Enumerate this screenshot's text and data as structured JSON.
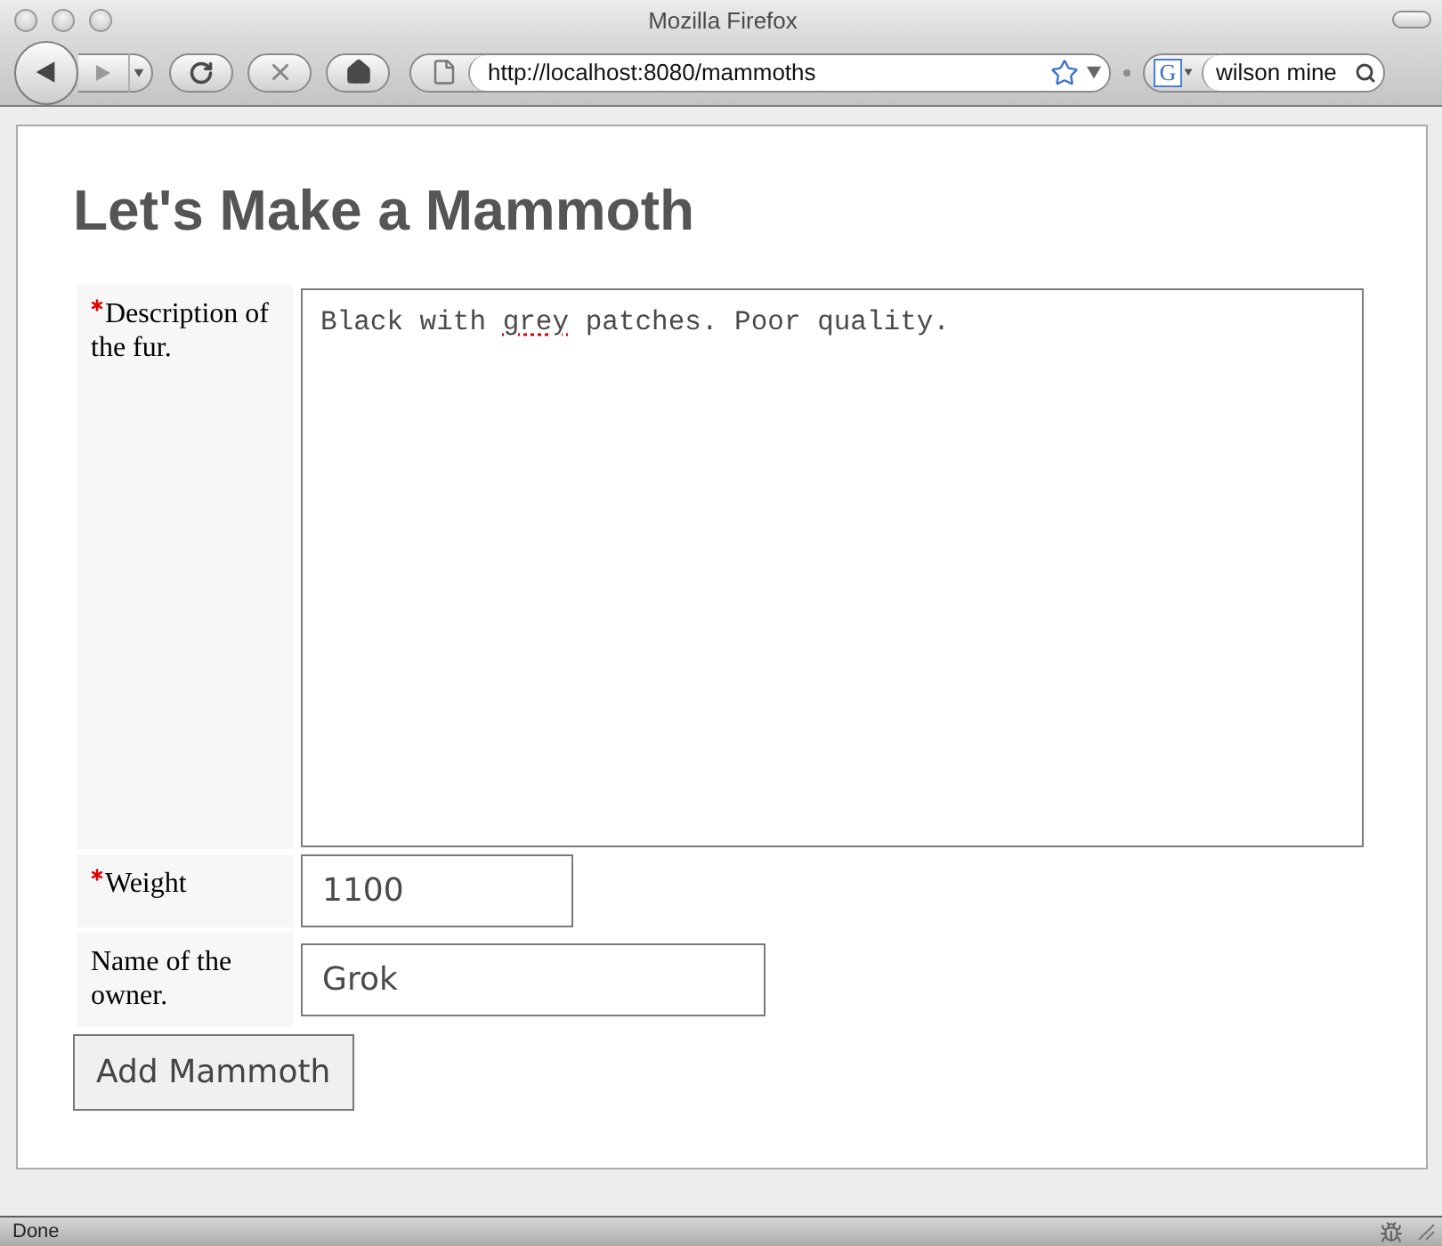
{
  "window": {
    "title": "Mozilla Firefox"
  },
  "toolbar": {
    "url": "http://localhost:8080/mammoths",
    "search_engine": "G",
    "search_value": "wilson mine"
  },
  "page": {
    "heading": "Let's Make a Mammoth",
    "fields": [
      {
        "kind": "textarea",
        "label": "Description of the fur.",
        "required": true,
        "segments": [
          {
            "text": "Black with ",
            "misspelled": false
          },
          {
            "text": "grey",
            "misspelled": true
          },
          {
            "text": " patches. Poor quality.",
            "misspelled": false
          }
        ]
      },
      {
        "kind": "text",
        "label": "Weight",
        "required": true,
        "value": "1100"
      },
      {
        "kind": "text",
        "label": "Name of the owner.",
        "required": false,
        "value": "Grok"
      }
    ],
    "submit": "Add Mammoth"
  },
  "status_bar": {
    "text": "Done"
  }
}
